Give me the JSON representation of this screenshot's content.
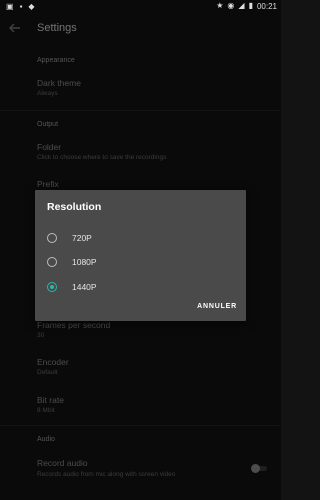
{
  "status_bar": {
    "time": "00:21",
    "left_icons": [
      "photo-icon",
      "lock-icon",
      "shield-icon"
    ],
    "right_icons": [
      "star-icon",
      "wifi-icon",
      "signal-icon",
      "battery-icon"
    ]
  },
  "toolbar": {
    "title": "Settings"
  },
  "sections": {
    "appearance": "Appearance",
    "output": "Output",
    "audio": "Audio"
  },
  "items": {
    "dark_theme": {
      "title": "Dark theme",
      "subtitle": "Always"
    },
    "folder": {
      "title": "Folder",
      "subtitle": "Click to choose where to save the recordings"
    },
    "prefix": {
      "title": "Prefix"
    },
    "frames_per_second": {
      "title": "Frames per second",
      "subtitle": "30"
    },
    "encoder": {
      "title": "Encoder",
      "subtitle": "Default"
    },
    "bit_rate": {
      "title": "Bit rate",
      "subtitle": "8 Mbit"
    },
    "record_audio": {
      "title": "Record audio",
      "subtitle": "Records audio from mic along with screen video"
    }
  },
  "dialog": {
    "title": "Resolution",
    "options": [
      "720P",
      "1080P",
      "1440P"
    ],
    "selected": "1440P",
    "cancel_label": "ANNULER"
  },
  "colors": {
    "accent": "#2ab7a9",
    "background": "#131313",
    "dialog": "#4a4a4a"
  }
}
